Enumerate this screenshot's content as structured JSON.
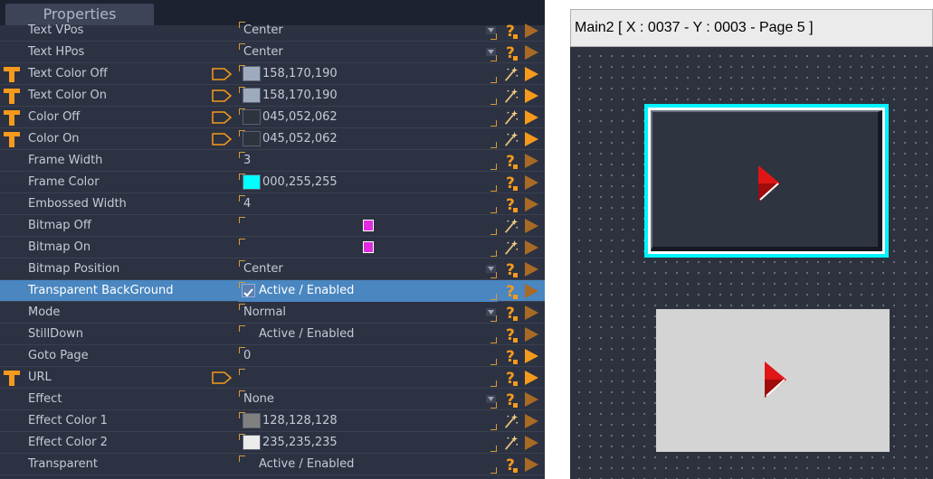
{
  "properties": {
    "tab_title": "Properties",
    "rows": [
      {
        "name": "Text VPos",
        "value": "Center",
        "kind": "dropdown",
        "t_icon": false,
        "tag": false,
        "icon1": "question-icon",
        "icon2": "play-icon-dim"
      },
      {
        "name": "Text HPos",
        "value": "Center",
        "kind": "dropdown",
        "t_icon": false,
        "tag": false,
        "icon1": "question-icon",
        "icon2": "play-icon-dim"
      },
      {
        "name": "Text Color Off",
        "value": "158,170,190",
        "kind": "color",
        "color": "#9eaabe",
        "t_icon": true,
        "tag": true,
        "icon1": "wand-icon",
        "icon2": "play-icon"
      },
      {
        "name": "Text Color On",
        "value": "158,170,190",
        "kind": "color",
        "color": "#9eaabe",
        "t_icon": true,
        "tag": true,
        "icon1": "wand-icon",
        "icon2": "play-icon"
      },
      {
        "name": "Color Off",
        "value": "045,052,062",
        "kind": "color",
        "color": "#2d343e",
        "t_icon": true,
        "tag": true,
        "icon1": "wand-icon",
        "icon2": "play-icon"
      },
      {
        "name": "Color On",
        "value": "045,052,062",
        "kind": "color",
        "color": "#2d343e",
        "t_icon": true,
        "tag": true,
        "icon1": "wand-icon",
        "icon2": "play-icon"
      },
      {
        "name": "Frame Width",
        "value": "3",
        "kind": "text",
        "t_icon": false,
        "tag": false,
        "icon1": "question-icon",
        "icon2": "play-icon-dim"
      },
      {
        "name": "Frame Color",
        "value": "000,255,255",
        "kind": "color",
        "color": "#00ffff",
        "t_icon": false,
        "tag": false,
        "icon1": "question-icon",
        "icon2": "play-icon-dim"
      },
      {
        "name": "Embossed Width",
        "value": "4",
        "kind": "text",
        "t_icon": false,
        "tag": false,
        "icon1": "question-icon",
        "icon2": "play-icon-dim"
      },
      {
        "name": "Bitmap Off",
        "value": "",
        "kind": "bitmap",
        "t_icon": false,
        "tag": false,
        "icon1": "wand-icon",
        "icon2": "play-icon-dim"
      },
      {
        "name": "Bitmap On",
        "value": "",
        "kind": "bitmap",
        "t_icon": false,
        "tag": false,
        "icon1": "wand-icon",
        "icon2": "play-icon-dim"
      },
      {
        "name": "Bitmap Position",
        "value": "Center",
        "kind": "dropdown",
        "t_icon": false,
        "tag": false,
        "icon1": "question-icon",
        "icon2": "play-icon-dim"
      },
      {
        "name": "Transparent BackGround",
        "value": "Active / Enabled",
        "kind": "checkbox",
        "checked": true,
        "selected": true,
        "t_icon": false,
        "tag": false,
        "icon1": "question-icon",
        "icon2": "play-icon-dim"
      },
      {
        "name": "Mode",
        "value": "Normal",
        "kind": "dropdown",
        "t_icon": false,
        "tag": false,
        "icon1": "question-icon",
        "icon2": "play-icon-dim"
      },
      {
        "name": "StillDown",
        "value": "Active / Enabled",
        "kind": "checkbox",
        "checked": false,
        "t_icon": false,
        "tag": false,
        "icon1": "question-icon",
        "icon2": "play-icon-dim"
      },
      {
        "name": "Goto Page",
        "value": "0",
        "kind": "text",
        "t_icon": false,
        "tag": false,
        "icon1": "question-icon",
        "icon2": "play-icon"
      },
      {
        "name": "URL",
        "value": "",
        "kind": "text",
        "t_icon": true,
        "tag": true,
        "icon1": "question-icon",
        "icon2": "play-icon"
      },
      {
        "name": "Effect",
        "value": "None",
        "kind": "dropdown",
        "t_icon": false,
        "tag": false,
        "icon1": "question-icon",
        "icon2": "play-icon-dim"
      },
      {
        "name": "Effect Color 1",
        "value": "128,128,128",
        "kind": "color",
        "color": "#808080",
        "t_icon": false,
        "tag": false,
        "icon1": "wand-icon",
        "icon2": "play-icon-dim"
      },
      {
        "name": "Effect Color 2",
        "value": "235,235,235",
        "kind": "color",
        "color": "#ebebeb",
        "t_icon": false,
        "tag": false,
        "icon1": "wand-icon",
        "icon2": "play-icon-dim"
      },
      {
        "name": "Transparent",
        "value": "Active / Enabled",
        "kind": "checkbox",
        "checked": false,
        "t_icon": false,
        "tag": false,
        "icon1": "question-icon",
        "icon2": "play-icon-dim"
      }
    ]
  },
  "design": {
    "title": "Main2 [ X : 0037 - Y : 0003 - Page 5 ]"
  },
  "colors": {
    "accent_orange": "#f59a1c",
    "frame_cyan": "#00f4ff",
    "selection_blue": "#4a86c0"
  }
}
